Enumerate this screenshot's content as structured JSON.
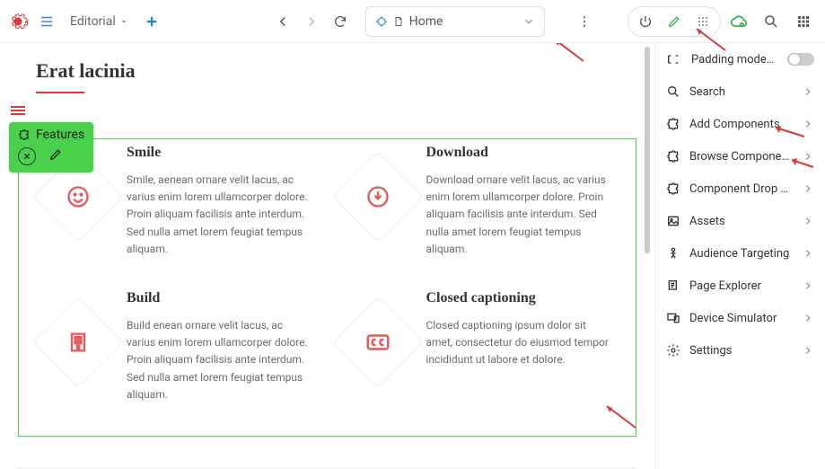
{
  "toolbar": {
    "workspace_label": "Editorial",
    "location": "Home"
  },
  "panel": {
    "padding_label": "Padding mode (p)",
    "items": [
      {
        "icon": "search-icon",
        "label": "Search"
      },
      {
        "icon": "puzzle-plus-icon",
        "label": "Add Components"
      },
      {
        "icon": "puzzle-icon",
        "label": "Browse Components"
      },
      {
        "icon": "puzzle-target-icon",
        "label": "Component Drop Ta..."
      },
      {
        "icon": "image-icon",
        "label": "Assets"
      },
      {
        "icon": "person-icon",
        "label": "Audience Targeting"
      },
      {
        "icon": "layers-icon",
        "label": "Page Explorer"
      },
      {
        "icon": "devices-icon",
        "label": "Device Simulator"
      },
      {
        "icon": "gear-icon",
        "label": "Settings"
      }
    ]
  },
  "page": {
    "heading": "Erat lacinia",
    "badge_label": "Features",
    "features": [
      {
        "title": "Smile",
        "icon": "smile-icon",
        "body": "Smile, aenean ornare velit lacus, ac varius enim lorem ullamcorper dolore. Proin aliquam facilisis ante interdum. Sed nulla amet lorem feugiat tempus aliquam."
      },
      {
        "title": "Download",
        "icon": "download-icon",
        "body": "Download ornare velit lacus, ac varius enim lorem ullamcorper dolore. Proin aliquam facilisis ante interdum. Sed nulla amet lorem feugiat tempus aliquam."
      },
      {
        "title": "Build",
        "icon": "building-icon",
        "body": "Build enean ornare velit lacus, ac varius enim lorem ullamcorper dolore. Proin aliquam facilisis ante interdum. Sed nulla amet lorem feugiat tempus aliquam."
      },
      {
        "title": "Closed captioning",
        "icon": "cc-icon",
        "body": "Closed captioning ipsum dolor sit amet, consectetur do eiusmod tempor incididunt ut labore et dolore."
      }
    ]
  },
  "colors": {
    "accent": "#d73a3a",
    "select": "#4ad04a"
  }
}
